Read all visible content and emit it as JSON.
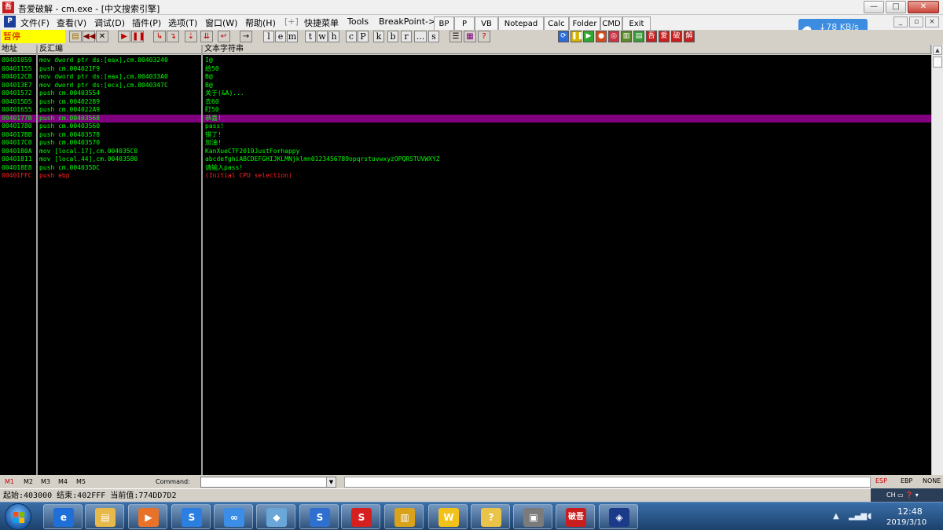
{
  "window": {
    "app_icon_text": "吾",
    "title": "吾爱破解 - cm.exe - [中文搜索引擎]",
    "buttons": {
      "minimize": "—",
      "maximize": "□",
      "close": "✕"
    }
  },
  "menu": {
    "mdi_icon_text": "P",
    "items": [
      "文件(F)",
      "查看(V)",
      "调试(D)",
      "插件(P)",
      "选项(T)",
      "窗口(W)",
      "帮助(H)",
      "[+]",
      "快捷菜单",
      "Tools",
      "BreakPoint->"
    ],
    "quick_buttons": [
      "BP",
      "P",
      "VB",
      "Notepad",
      "Calc",
      "Folder",
      "CMD",
      "Exit"
    ],
    "mdi_buttons": {
      "minimize": "_",
      "restore": "▫",
      "close": "×"
    }
  },
  "network_widget": {
    "icon": "cloud-icon",
    "speed": "↓78 KB/s"
  },
  "toolbar": {
    "status": "暂停",
    "letters": [
      "l",
      "e",
      "m",
      "t",
      "w",
      "h",
      "c",
      "P",
      "k",
      "b",
      "r",
      "...",
      "s"
    ],
    "chinese_buttons": [
      "吾",
      "爱",
      "破",
      "解"
    ]
  },
  "panes": {
    "headers": {
      "address": "地址",
      "disasm": "反汇编",
      "text": "文本字符串"
    },
    "rows": [
      {
        "addr": "00401059",
        "disasm": "mov dword ptr ds:[eax],cm.00403240",
        "text": "I@"
      },
      {
        "addr": "00401155",
        "disasm": "push cm.004021F9",
        "text": "给50"
      },
      {
        "addr": "004012CB",
        "disasm": "mov dword ptr ds:[eax],cm.004033A0",
        "text": "B@"
      },
      {
        "addr": "004013E7",
        "disasm": "mov dword ptr ds:[ecx],cm.0040347C",
        "text": "B@"
      },
      {
        "addr": "00401572",
        "disasm": "push cm.00403554",
        "text": "关于(&A)..."
      },
      {
        "addr": "004015D5",
        "disasm": "push cm.00402289",
        "text": "去60"
      },
      {
        "addr": "00401655",
        "disasm": "push cm.004022A9",
        "text": "盯50"
      },
      {
        "addr": "0040177B",
        "disasm": "push cm.00403568",
        "text": "恭喜!",
        "highlight": true
      },
      {
        "addr": "00401780",
        "disasm": "push cm.00403560",
        "text": "pass!"
      },
      {
        "addr": "004017BB",
        "disasm": "push cm.00403578",
        "text": "错了!"
      },
      {
        "addr": "004017C0",
        "disasm": "push cm.00403570",
        "text": "加油!"
      },
      {
        "addr": "0040180A",
        "disasm": "mov [local.17],cm.004035C0",
        "text": "KanXueCTF2019JustForhappy"
      },
      {
        "addr": "00401811",
        "disasm": "mov [local.44],cm.00403580",
        "text": "abcdefghiABCDEFGHIJKLMNjklmn0123456789opqrstuvwxyzOPQRSTUVWXYZ"
      },
      {
        "addr": "004018E8",
        "disasm": "push cm.004035DC",
        "text": "请输入pass!"
      },
      {
        "addr": "00401FFC",
        "disasm": "push ebp",
        "text": "(Initial CPU selection)",
        "red": true
      }
    ]
  },
  "command_bar": {
    "tabs": [
      "M1",
      "M2",
      "M3",
      "M4",
      "M5"
    ],
    "command_label": "Command:",
    "regs": [
      "ESP",
      "EBP",
      "NONE"
    ]
  },
  "info_bar": {
    "text": "起始:403000 结束:402FFF 当前值:774DD7D2"
  },
  "lang_bar": {
    "text": "CH ▭ ❓ ▾"
  },
  "taskbar": {
    "apps": [
      {
        "icon": "ie-icon",
        "label": "e",
        "color": "#1f6fd8"
      },
      {
        "icon": "explorer-icon",
        "label": "▤",
        "color": "#e6b94a"
      },
      {
        "icon": "media-player-icon",
        "label": "▶",
        "color": "#e8722a"
      },
      {
        "icon": "sogou-icon",
        "label": "S",
        "color": "#2b7fe0"
      },
      {
        "icon": "baidu-netdisk-icon",
        "label": "∞",
        "color": "#3b8de6"
      },
      {
        "icon": "notes-icon",
        "label": "◆",
        "color": "#6aa6d8"
      },
      {
        "icon": "download-icon",
        "label": "S",
        "color": "#2f6fd0"
      },
      {
        "icon": "flash-icon",
        "label": "S",
        "color": "#d62020"
      },
      {
        "icon": "archive-icon",
        "label": "▥",
        "color": "#d9a21a"
      },
      {
        "icon": "wps-icon",
        "label": "W",
        "color": "#f2c21b"
      },
      {
        "icon": "help-icon",
        "label": "?",
        "color": "#e9c34a"
      },
      {
        "icon": "printer-icon",
        "label": "▣",
        "color": "#7b7b7b"
      },
      {
        "icon": "52pojie-icon",
        "label": "破吾",
        "color": "#c81e1e"
      },
      {
        "icon": "cube-icon",
        "label": "◈",
        "color": "#1b3b8a"
      }
    ],
    "tray": {
      "time": "12:48",
      "date": "2019/3/10"
    }
  }
}
